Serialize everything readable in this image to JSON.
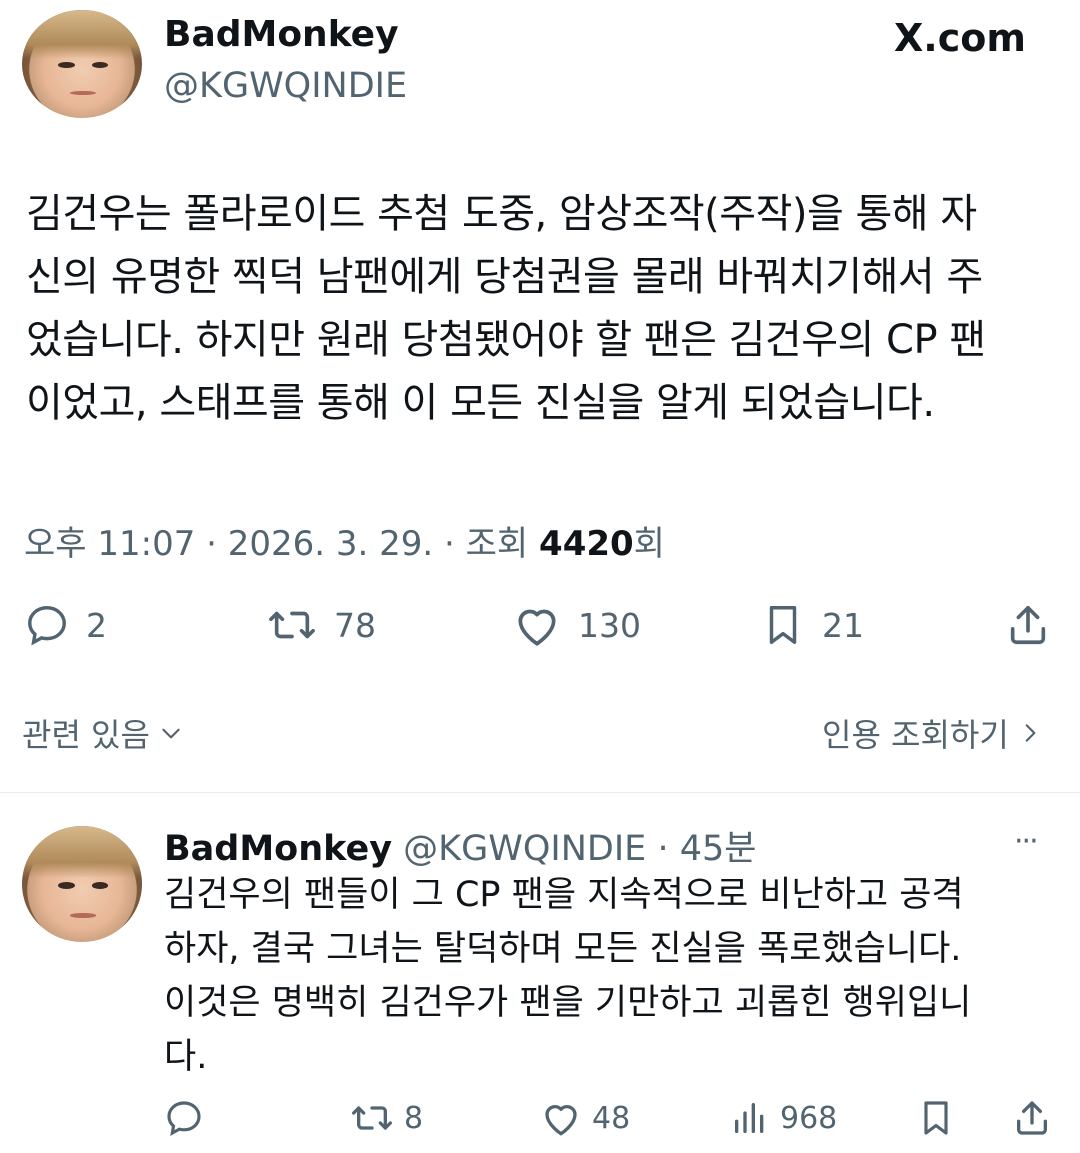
{
  "tweet": {
    "author_name": "BadMonkey",
    "author_handle": "@KGWQINDIE",
    "source": "X.com",
    "text": "김건우는 폴라로이드 추첨 도중, 암상조작(주작)을 통해 자신의 유명한 찍덕 남팬에게 당첨권을 몰래 바꿔치기해서 주었습니다. 하지만 원래 당첨됐어야 할 팬은 김건우의 CP 팬이었고, 스태프를 통해 이 모든 진실을 알게 되었습니다.",
    "lines": [
      "김건우는 폴라로이드 추첨 도중, 암상조작(주작)을 통해 자",
      "신의 유명한 찍덕 남팬에게 당첨권을 몰래 바꿔치기해서 주",
      "었습니다. 하지만 원래 당첨됐어야 할 팬은 김건우의 CP 팬",
      "이었고, 스태프를 통해 이 모든 진실을 알게 되었습니다."
    ],
    "time": "오후 11:07 · 2026. 3. 29. · 조회 ",
    "views": "4420",
    "views_suffix": "회",
    "actions": {
      "reply_count": "2",
      "retweet_count": "78",
      "like_count": "130",
      "bookmark_count": "21"
    },
    "related_label": "관련 있음",
    "quote_label": "인용 조회하기"
  },
  "reply": {
    "author_name": "BadMonkey",
    "author_handle": "@KGWQINDIE",
    "age": "· 45분",
    "more": "···",
    "lines": [
      "김건우의 팬들이 그 CP 팬을 지속적으로 비난하고 공격",
      "하자, 결국 그녀는 탈덕하며 모든 진실을 폭로했습니다.",
      "이것은 명백히 김건우가 팬을 기만하고 괴롭힌 행위입니",
      "다."
    ],
    "actions": {
      "retweet_count": "8",
      "like_count": "48",
      "views_count": "968"
    }
  },
  "colors": {
    "text": "#0f1419",
    "secondary": "#536471",
    "divider": "#e6ecf0"
  }
}
